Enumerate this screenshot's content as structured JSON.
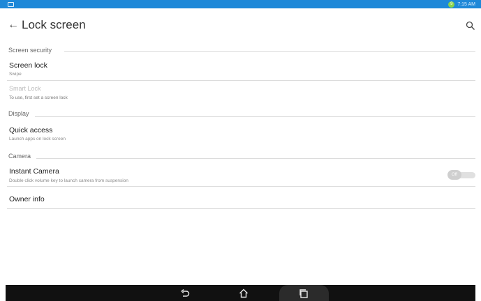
{
  "status_bar": {
    "left_icon": "notification-icon",
    "badge": "9",
    "time": "7:15 AM"
  },
  "action_bar": {
    "title": "Lock screen",
    "back_icon": "back-arrow-icon",
    "search_icon": "search-icon"
  },
  "sections": {
    "screen_security": {
      "header": "Screen security",
      "screen_lock": {
        "title": "Screen lock",
        "subtitle": "Swipe"
      },
      "smart_lock": {
        "title": "Smart Lock",
        "subtitle": "To use, first set a screen lock",
        "enabled": false
      }
    },
    "display": {
      "header": "Display",
      "quick_access": {
        "title": "Quick access",
        "subtitle": "Launch apps on lock screen"
      }
    },
    "camera": {
      "header": "Camera",
      "instant_camera": {
        "title": "Instant Camera",
        "subtitle": "Double click volume key to launch camera from suspension",
        "toggle_label": "Off",
        "toggle_on": false
      }
    },
    "owner": {
      "owner_info": {
        "title": "Owner info"
      }
    }
  },
  "nav_bar": {
    "back": "nav-back-icon",
    "home": "nav-home-icon",
    "recents": "nav-recents-icon"
  },
  "colors": {
    "status_bar": "#1e88d8",
    "nav_bar": "#111111",
    "divider": "#dcdcdc"
  }
}
